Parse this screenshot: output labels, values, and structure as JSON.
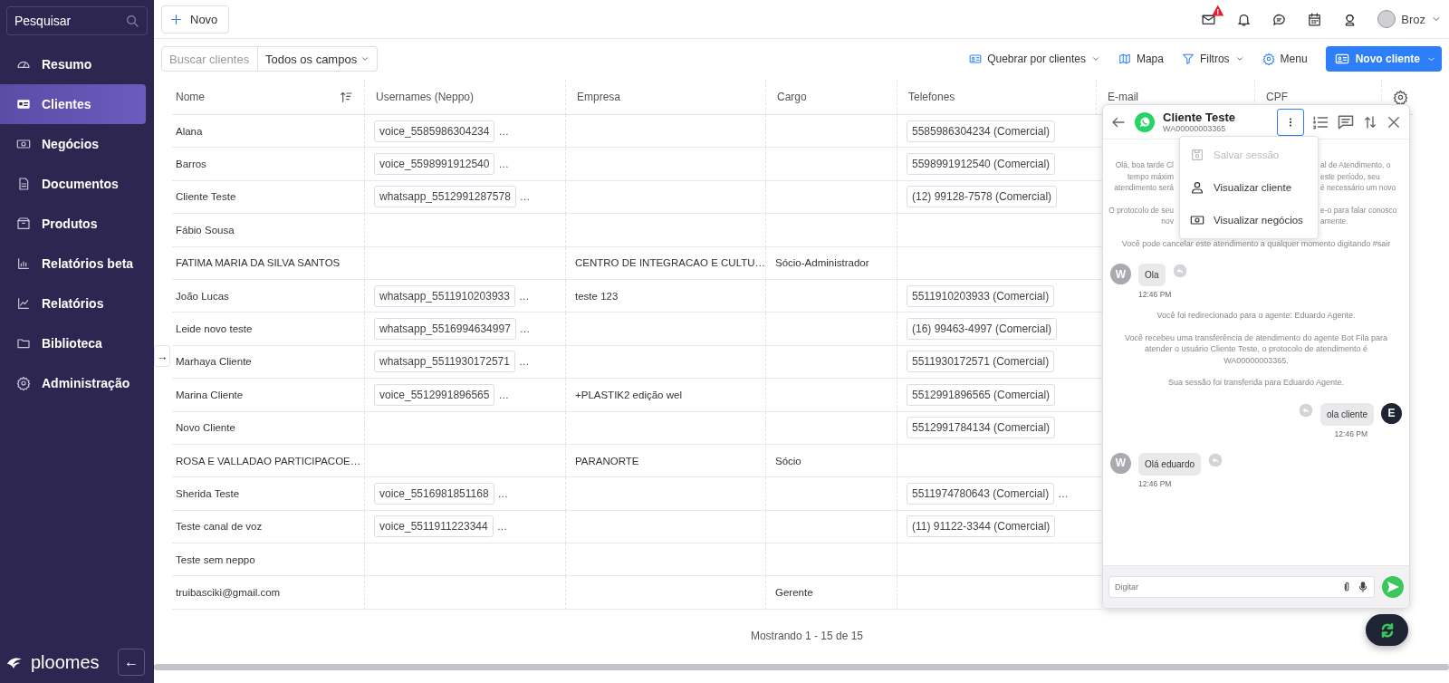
{
  "sidebar": {
    "search_placeholder": "Pesquisar",
    "items": [
      {
        "label": "Resumo",
        "selected": false
      },
      {
        "label": "Clientes",
        "selected": true
      },
      {
        "label": "Negócios",
        "selected": false
      },
      {
        "label": "Documentos",
        "selected": false
      },
      {
        "label": "Produtos",
        "selected": false
      },
      {
        "label": "Relatórios beta",
        "selected": false
      },
      {
        "label": "Relatórios",
        "selected": false
      },
      {
        "label": "Biblioteca",
        "selected": false
      },
      {
        "label": "Administração",
        "selected": false
      }
    ],
    "logo": "ploomes",
    "collapse": "←"
  },
  "topbar": {
    "new_button": "Novo",
    "mail_badge": "!",
    "user": "Broz"
  },
  "toolbar": {
    "search_placeholder": "Buscar clientes",
    "field_select": "Todos os campos",
    "actions": [
      "Quebrar por clientes",
      "Mapa",
      "Filtros",
      "Menu"
    ],
    "primary": "Novo cliente"
  },
  "table": {
    "columns": [
      "Nome",
      "Usernames (Neppo)",
      "Empresa",
      "Cargo",
      "Telefones",
      "E-mail",
      "CPF"
    ],
    "expand": "→",
    "rows": [
      {
        "name": "Alana",
        "username": "voice_5585986304234",
        "username_more": "…",
        "company": "",
        "role": "",
        "phone": "5585986304234 (Comercial)"
      },
      {
        "name": "Barros",
        "username": "voice_5598991912540",
        "username_more": "…",
        "company": "",
        "role": "",
        "phone": "5598991912540 (Comercial)"
      },
      {
        "name": "Cliente Teste",
        "username": "whatsapp_5512991287578",
        "username_more": "…",
        "company": "",
        "role": "",
        "phone": "(12) 99128-7578 (Comercial)"
      },
      {
        "name": "Fábio Sousa",
        "username": "",
        "company": "",
        "role": "",
        "phone": ""
      },
      {
        "name": "FATIMA MARIA DA SILVA SANTOS",
        "username": "",
        "company": "CENTRO DE INTEGRACAO E CULTU…",
        "role": "Sócio-Administrador",
        "phone": ""
      },
      {
        "name": "João Lucas",
        "username": "whatsapp_5511910203933",
        "username_more": "…",
        "company": "teste 123",
        "role": "",
        "phone": "5511910203933 (Comercial)"
      },
      {
        "name": "Leide novo teste",
        "username": "whatsapp_5516994634997",
        "username_more": "…",
        "company": "",
        "role": "",
        "phone": "(16) 99463-4997 (Comercial)"
      },
      {
        "name": "Marhaya Cliente",
        "username": "whatsapp_5511930172571",
        "username_more": "…",
        "company": "",
        "role": "",
        "phone": "5511930172571 (Comercial)"
      },
      {
        "name": "Marina Cliente",
        "username": "voice_5512991896565",
        "username_more": "…",
        "company": "+PLASTIK2 edição wel",
        "role": "",
        "phone": "5512991896565 (Comercial)"
      },
      {
        "name": "Novo Cliente",
        "username": "",
        "company": "",
        "role": "",
        "phone": "5512991784134 (Comercial)"
      },
      {
        "name": "ROSA E VALLADAO PARTICIPACOE…",
        "username": "",
        "company": "PARANORTE",
        "role": "Sócio",
        "phone": ""
      },
      {
        "name": "Sherida Teste",
        "username": "voice_5516981851168",
        "username_more": "…",
        "company": "",
        "role": "",
        "phone": "5511974780643 (Comercial)",
        "phone_more": "…"
      },
      {
        "name": "Teste canal de voz",
        "username": "voice_5511911223344",
        "username_more": "…",
        "company": "",
        "role": "",
        "phone": "(11) 91122-3344 (Comercial)"
      },
      {
        "name": "Teste sem neppo",
        "username": "",
        "company": "",
        "role": "",
        "phone": ""
      },
      {
        "name": "truibasciki@gmail.com",
        "username": "",
        "company": "",
        "role": "Gerente",
        "phone": ""
      }
    ],
    "footer": "Mostrando 1 - 15 de 15"
  },
  "chat": {
    "contact": "Cliente Teste",
    "protocol": "WA00000003365",
    "menu_open": true,
    "menu": [
      {
        "label": "Salvar sessão",
        "disabled": true
      },
      {
        "label": "Visualizar cliente",
        "disabled": false
      },
      {
        "label": "Visualizar negócios",
        "disabled": false
      }
    ],
    "messages": [
      {
        "kind": "split",
        "lines": [
          [
            "Olá, boa tarde Cl",
            "al de Atendimento, o"
          ],
          [
            "tempo máxim",
            "este período, seu"
          ],
          [
            "atendimento será",
            "é necessário um novo"
          ]
        ]
      },
      {
        "kind": "split",
        "lines": [
          [
            "O protocolo de seu",
            "e-o para falar conosco"
          ],
          [
            "nov",
            "amente."
          ]
        ]
      },
      {
        "kind": "system",
        "text": "Você pode cancelar este atendimento a qualquer momento digitando #sair"
      },
      {
        "kind": "incoming",
        "avatar": "W",
        "text": "Ola",
        "time": "12:46 PM"
      },
      {
        "kind": "system",
        "text": "Você foi redirecionado para o agente: Eduardo Agente."
      },
      {
        "kind": "system",
        "text": "Você recebeu uma transferência de atendimento do agente Bot Fila para atender o usuário Cliente Teste, o protocolo de atendimento é WA00000003365."
      },
      {
        "kind": "system",
        "text": "Sua sessão foi transferida para Eduardo Agente."
      },
      {
        "kind": "outgoing",
        "avatar": "E",
        "text": "ola cliente",
        "time": "12:46 PM"
      },
      {
        "kind": "incoming",
        "avatar": "W",
        "text": "Olá eduardo",
        "time": "12:46 PM"
      }
    ],
    "input_placeholder": "Digitar"
  }
}
